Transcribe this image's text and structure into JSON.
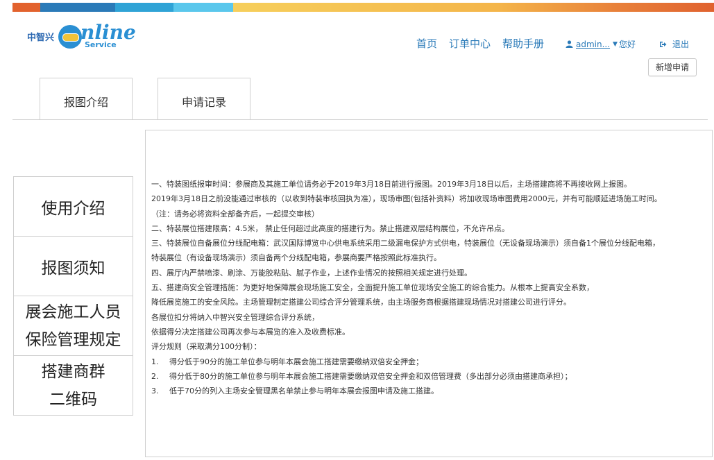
{
  "logo": {
    "cn": "中智兴",
    "word": "nline",
    "service": "Service"
  },
  "nav": {
    "home": "首页",
    "orders": "订单中心",
    "help": "帮助手册"
  },
  "user": {
    "name": "admin...",
    "greeting": "您好",
    "logout": "退出"
  },
  "new_button": "新增申请",
  "tabs": [
    "报图介绍",
    "申请记录"
  ],
  "side_menu": [
    {
      "lines": [
        "使用介绍"
      ]
    },
    {
      "lines": [
        "报图须知"
      ]
    },
    {
      "lines": [
        "展会施工人员",
        "保险管理规定"
      ]
    },
    {
      "lines": [
        "搭建商群",
        "二维码"
      ]
    }
  ],
  "content_lines": [
    "一、特装图纸报审时间：参展商及其施工单位请务必于2019年3月18日前进行报图。2019年3月18日以后，主场搭建商将不再接收网上报图。",
    "2019年3月18日之前没能通过审核的（以收到特装审核回执为准），现场审图(包括补资料）将加收现场审图费用2000元，并有可能顺延进场施工时间。",
    "（注：请务必将资料全部备齐后，一起提交审核）",
    "二、特装展位搭建限高：4.5米， 禁止任何超过此高度的搭建行为。禁止搭建双层结构展位，不允许吊点。",
    "三、特装展位自备展位分线配电箱：武汉国际博览中心供电系统采用二级漏电保护方式供电，特装展位（无设备现场演示）须自备1个展位分线配电箱，",
    "特装展位（有设备现场演示）须自备两个分线配电箱，参展商要严格按照此标准执行。",
    "四、展厅内严禁喷漆、刷涂、万能胶粘贴、腻子作业，上述作业情况的按照相关规定进行处理。",
    "五、搭建商安全管理措施：为更好地保障展会现场施工安全，全面提升施工单位现场安全施工的综合能力。从根本上提高安全系数，",
    "降低展览施工的安全风险。主场管理制定搭建公司综合评分管理系统，由主场服务商根据搭建现场情况对搭建公司进行评分。",
    "各展位扣分将纳入中智兴安全管理综合评分系统，",
    "依据得分决定搭建公司再次参与本展览的准入及收费标准。",
    "评分规则（采取满分100分制）："
  ],
  "rules": [
    {
      "num": "1.",
      "text": "得分低于90分的施工单位参与明年本展会施工搭建需要缴纳双倍安全押金；"
    },
    {
      "num": "2.",
      "text": "得分低于80分的施工单位参与明年本展会施工搭建需要缴纳双倍安全押金和双倍管理费（多出部分必须由搭建商承担）；"
    },
    {
      "num": "3.",
      "text": "低于70分的列入主场安全管理黑名单禁止参与明年本展会报图申请及施工搭建。"
    }
  ]
}
